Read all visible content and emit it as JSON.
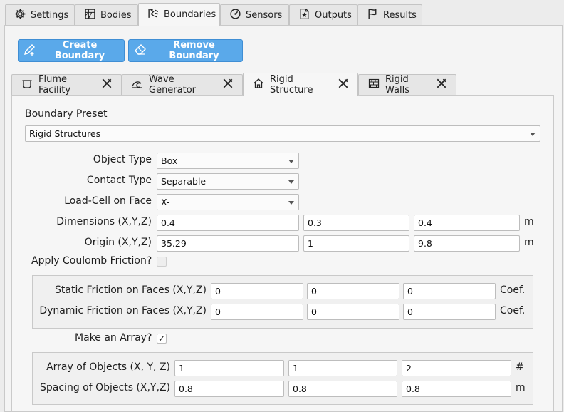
{
  "main_tabs": [
    {
      "label": "Settings",
      "icon": "gear-icon"
    },
    {
      "label": "Bodies",
      "icon": "bodies-icon"
    },
    {
      "label": "Boundaries",
      "icon": "boundaries-icon",
      "active": true
    },
    {
      "label": "Sensors",
      "icon": "sensor-icon"
    },
    {
      "label": "Outputs",
      "icon": "outputs-icon"
    },
    {
      "label": "Results",
      "icon": "flag-icon"
    }
  ],
  "toolbar": {
    "create_label": "Create Boundary",
    "remove_label": "Remove Boundary",
    "accent_color": "#5aa9ea"
  },
  "boundary_tabs": [
    {
      "label": "Flume Facility",
      "icon": "flume-icon",
      "close": "×"
    },
    {
      "label": "Wave Generator",
      "icon": "wave-icon",
      "close": "×"
    },
    {
      "label": "Rigid Structure",
      "icon": "house-icon",
      "close": "×",
      "active": true
    },
    {
      "label": "Rigid Walls",
      "icon": "wall-icon",
      "close": "×"
    }
  ],
  "form": {
    "preset_label": "Boundary Preset",
    "preset_value": "Rigid Structures",
    "object_type_label": "Object Type",
    "object_type_value": "Box",
    "contact_type_label": "Contact Type",
    "contact_type_value": "Separable",
    "load_cell_label": "Load-Cell on Face",
    "load_cell_value": "X-",
    "dimensions_label": "Dimensions (X,Y,Z)",
    "dimensions": [
      "0.4",
      "0.3",
      "0.4"
    ],
    "dimensions_unit": "m",
    "origin_label": "Origin (X,Y,Z)",
    "origin": [
      "35.29",
      "1",
      "9.8"
    ],
    "origin_unit": "m",
    "coulomb_label": "Apply Coulomb Friction?",
    "coulomb_checked": false,
    "static_friction_label": "Static Friction on Faces (X,Y,Z)",
    "static_friction": [
      "0",
      "0",
      "0"
    ],
    "static_unit": "Coef.",
    "dynamic_friction_label": "Dynamic Friction on Faces (X,Y,Z)",
    "dynamic_friction": [
      "0",
      "0",
      "0"
    ],
    "dynamic_unit": "Coef.",
    "array_label": "Make an Array?",
    "array_checked": true,
    "array_mark": "✓",
    "array_objects_label": "Array of Objects (X, Y, Z)",
    "array_objects": [
      "1",
      "1",
      "2"
    ],
    "array_objects_unit": "#",
    "spacing_label": "Spacing of Objects (X,Y,Z)",
    "spacing": [
      "0.8",
      "0.8",
      "0.8"
    ],
    "spacing_unit": "m"
  }
}
